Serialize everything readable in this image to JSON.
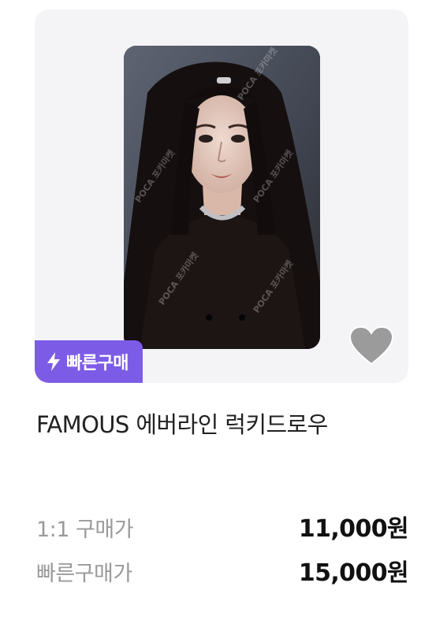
{
  "product": {
    "badge_label": "빠른구매",
    "badge_icon": "lightning-bolt-icon",
    "wishlist_icon": "heart-icon",
    "title": "FAMOUS 에버라인 럭키드로우",
    "image_watermark": "POCA 포카마켓"
  },
  "prices": [
    {
      "label": "1:1 구매가",
      "value": "11,000원"
    },
    {
      "label": "빠른구매가",
      "value": "15,000원"
    }
  ],
  "colors": {
    "badge_bg": "#7c5ce6",
    "card_bg": "#f4f4f6",
    "heart": "#9b9b9b",
    "label_gray": "#9a9a9a"
  }
}
